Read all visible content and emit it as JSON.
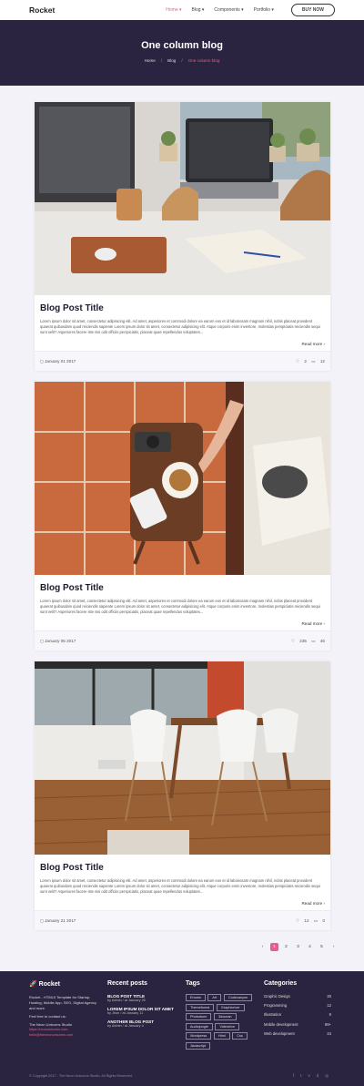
{
  "nav": {
    "logo": "Rocket",
    "items": [
      "Home ▾",
      "Blog ▾",
      "Components ▾",
      "Portfolio ▾"
    ],
    "cta": "BUY NOW"
  },
  "hero": {
    "title": "One column blog",
    "crumbs": [
      "Home",
      "Blog",
      "One column blog"
    ]
  },
  "posts": [
    {
      "title": "Blog Post Title",
      "excerpt": "Lorem ipsum dolor sit amet, consectetur adipisicing elit. Ad amet, asperiores et commodi dolore ea earum eos et id laboriosam magnam nihil, nobis placeat provident quaerat quibusdam quod reiciendis sapiente Lorem ipsum dolor sit amet, consectetur adipisicing elit. Atque corporis enim inventore, molestias perspiciatis reiciendis sequi sunt velit? Asperiores facere iste nisi odit officiis perspiciatis, placeat quae repellendus voluptates...",
      "read_more": "Read more",
      "date": "January 01 2017",
      "likes": "2",
      "comments": "12"
    },
    {
      "title": "Blog Post Title",
      "excerpt": "Lorem ipsum dolor sit amet, consectetur adipisicing elit. Ad amet, asperiores et commodi dolore ea earum eos et id laboriosam magnam nihil, nobis placeat provident quaerat quibusdam quod reiciendis sapiente Lorem ipsum dolor sit amet, consectetur adipisicing elit. Atque corporis enim inventore, molestias perspiciatis reiciendis sequi sunt velit? Asperiores facere iste nisi odit officiis perspiciatis, placeat quae repellendus voluptates...",
      "read_more": "Read more",
      "date": "January 05 2017",
      "likes": "235",
      "comments": "46"
    },
    {
      "title": "Blog Post Title",
      "excerpt": "Lorem ipsum dolor sit amet, consectetur adipisicing elit. Ad amet, asperiores et commodi dolore ea earum eos et id laboriosam magnam nihil, nobis placeat provident quaerat quibusdam quod reiciendis sapiente Lorem ipsum dolor sit amet, consectetur adipisicing elit. Atque corporis enim inventore, molestias perspiciatis reiciendis sequi sunt velit? Asperiores facere iste nisi odit officiis perspiciatis, placeat quae repellendus voluptates...",
      "read_more": "Read more",
      "date": "January 21 2017",
      "likes": "12",
      "comments": "0"
    }
  ],
  "pagination": [
    "‹",
    "1",
    "2",
    "3",
    "4",
    "5",
    "›"
  ],
  "footer": {
    "brand": "Rocket",
    "about": "Rocket - HTML5 Template for Startup, Hosting, Mobile App, SEO, Digital Agency and more.",
    "contact_label": "Feel free to contact us:",
    "studio": "The Neon Unicorns Studio",
    "link1": "https://neonunicorns.com",
    "link2": "hello@theneonunicorns.com",
    "recent_title": "Recent posts",
    "recent": [
      {
        "title": "BLOG POST TITLE",
        "meta": "by Admin / at January 25"
      },
      {
        "title": "LOREM IPSUM DOLOR SIT AMET",
        "meta": "by Jhon / at January 11"
      },
      {
        "title": "ANOTHER BLOG POST",
        "meta": "by Admin / at January 4"
      }
    ],
    "tags_title": "Tags",
    "tags": [
      "Envato",
      "Art",
      "Codecanyon",
      "Themeforest",
      "Graphicriver",
      "Photodune",
      "3docean",
      "Audiojungle",
      "Videohive",
      "Wordpress",
      "Html",
      "Css",
      "Javascript"
    ],
    "cats_title": "Categories",
    "cats": [
      {
        "name": "Graphic Design",
        "count": "20"
      },
      {
        "name": "Programming",
        "count": "12"
      },
      {
        "name": "Illustration",
        "count": "9"
      },
      {
        "name": "Mobile development",
        "count": "99+"
      },
      {
        "name": "Web development",
        "count": "24"
      }
    ],
    "copyright": "© Copyright 2017 - The Neon Unicorns Studio. All Rights Reserved.",
    "social": [
      "f",
      "t",
      "v",
      "d",
      "◎"
    ]
  },
  "colors": {
    "accent": "#e85d8a",
    "dark": "#2b2440"
  }
}
